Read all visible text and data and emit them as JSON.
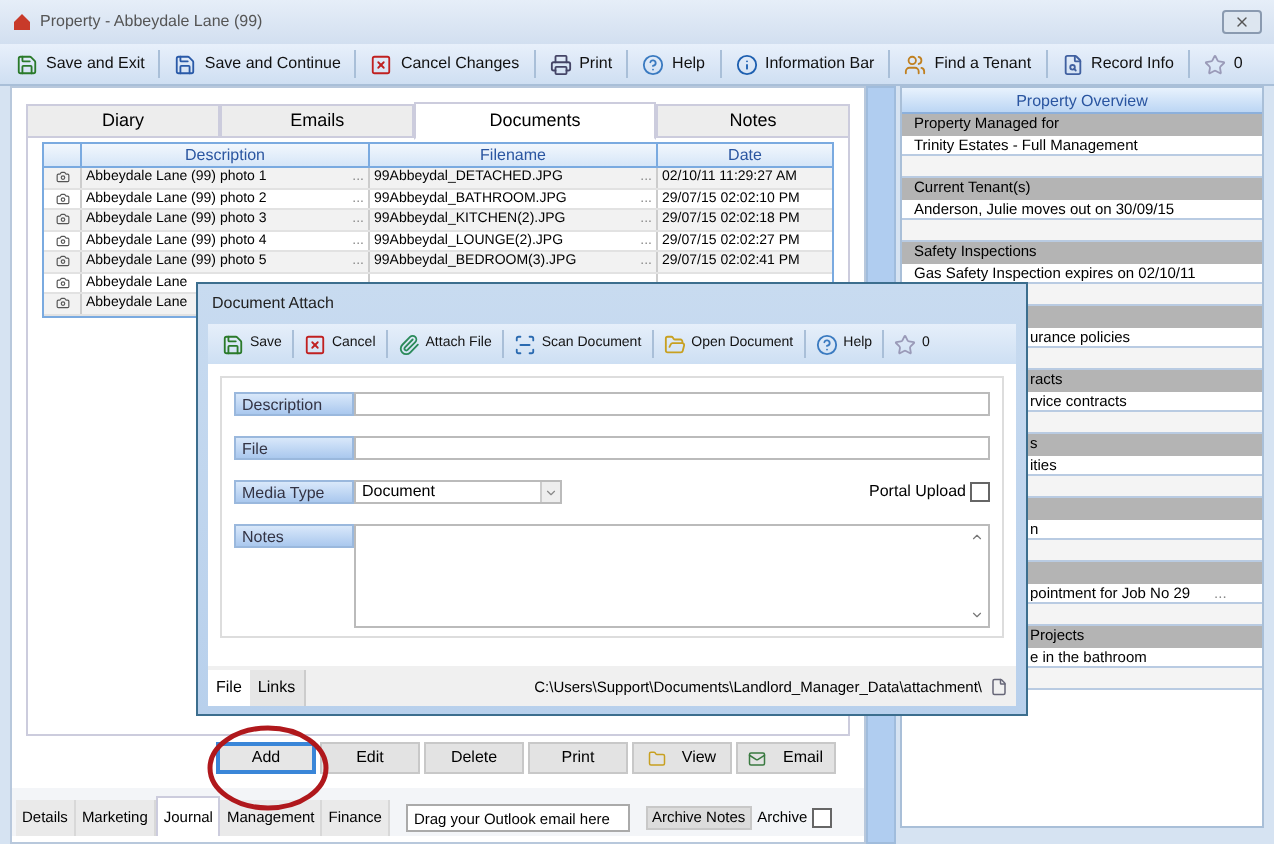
{
  "window": {
    "title": "Property  - Abbeydale Lane (99)"
  },
  "toolbar": [
    {
      "label": "Save and Exit"
    },
    {
      "label": "Save and Continue"
    },
    {
      "label": "Cancel Changes"
    },
    {
      "label": "Print"
    },
    {
      "label": "Help"
    },
    {
      "label": "Information Bar"
    },
    {
      "label": "Find a Tenant"
    },
    {
      "label": "Record Info"
    },
    {
      "label": "0"
    }
  ],
  "tabs": [
    {
      "label": "Diary",
      "selected": false
    },
    {
      "label": "Emails",
      "selected": false
    },
    {
      "label": "Documents",
      "selected": true
    },
    {
      "label": "Notes",
      "selected": false
    }
  ],
  "table": {
    "columns": [
      "Description",
      "Filename",
      "Date"
    ],
    "rows": [
      {
        "description": "Abbeydale Lane (99) photo 1",
        "description_more": "...",
        "filename": "99Abbeydal_DETACHED.JPG",
        "filename_more": "...",
        "date": "02/10/11 11:29:27 AM"
      },
      {
        "description": "Abbeydale Lane (99) photo 2",
        "description_more": "...",
        "filename": "99Abbeydal_BATHROOM.JPG",
        "filename_more": "...",
        "date": "29/07/15 02:02:10 PM"
      },
      {
        "description": "Abbeydale Lane (99) photo 3",
        "description_more": "...",
        "filename": "99Abbeydal_KITCHEN(2).JPG",
        "filename_more": "...",
        "date": "29/07/15 02:02:18 PM"
      },
      {
        "description": "Abbeydale Lane (99) photo 4",
        "description_more": "...",
        "filename": "99Abbeydal_LOUNGE(2).JPG",
        "filename_more": "...",
        "date": "29/07/15 02:02:27 PM"
      },
      {
        "description": "Abbeydale Lane (99) photo 5",
        "description_more": "...",
        "filename": "99Abbeydal_BEDROOM(3).JPG",
        "filename_more": "...",
        "date": "29/07/15 02:02:41 PM"
      },
      {
        "description": "Abbeydale Lane"
      },
      {
        "description": "Abbeydale Lane"
      }
    ]
  },
  "actions": [
    {
      "label": "Add",
      "highlighted": true
    },
    {
      "label": "Edit",
      "highlighted": false
    },
    {
      "label": "Delete",
      "highlighted": false
    },
    {
      "label": "Print",
      "highlighted": false
    },
    {
      "label": "View",
      "highlighted": false
    },
    {
      "label": "Email",
      "highlighted": false
    }
  ],
  "bottom_tabs": [
    {
      "label": "Details",
      "selected": false
    },
    {
      "label": "Marketing",
      "selected": false
    },
    {
      "label": "Journal",
      "selected": true
    },
    {
      "label": "Management",
      "selected": false
    },
    {
      "label": "Finance",
      "selected": false
    }
  ],
  "outlook_drop": {
    "value": "Drag your Outlook email here"
  },
  "archive_notes": "Archive Notes",
  "archive": {
    "label": "Archive",
    "checked": false
  },
  "overview": {
    "title": "Property Overview",
    "sections": [
      {
        "heading": "Property Managed for",
        "value": "Trinity Estates - Full Management",
        "clipped": false
      },
      {
        "heading": "Current Tenant(s)",
        "value": "Anderson, Julie moves out on 30/09/15",
        "clipped": false
      },
      {
        "heading": "Safety Inspections",
        "value": "Gas Safety Inspection expires on 02/10/11",
        "clipped": false
      },
      {
        "value": "urance policies",
        "clipped": true
      },
      {
        "heading": "racts",
        "value": "rvice contracts",
        "clipped": true
      },
      {
        "heading": "s",
        "value": "ities",
        "clipped": true
      },
      {
        "value": "n",
        "clipped": true
      },
      {
        "value": "pointment for Job No 29",
        "more": "...",
        "clipped": true
      },
      {
        "heading": "Projects",
        "value": "e in the bathroom",
        "clipped": true
      }
    ]
  },
  "dialog": {
    "title": "Document Attach",
    "toolbar": [
      {
        "label": "Save"
      },
      {
        "label": "Cancel"
      },
      {
        "label": "Attach File"
      },
      {
        "label": "Scan Document"
      },
      {
        "label": "Open Document"
      },
      {
        "label": "Help"
      },
      {
        "label": "0"
      }
    ],
    "description": {
      "label": "Description"
    },
    "file": {
      "label": "File"
    },
    "media_type": {
      "label": "Media Type",
      "value": "Document"
    },
    "portal_upload": {
      "label": "Portal Upload",
      "checked": false
    },
    "notes": {
      "label": "Notes"
    },
    "tabs": [
      {
        "label": "File",
        "selected": true
      },
      {
        "label": "Links",
        "selected": false
      }
    ],
    "path": "C:\\Users\\Support\\Documents\\Landlord_Manager_Data\\attachment\\"
  }
}
